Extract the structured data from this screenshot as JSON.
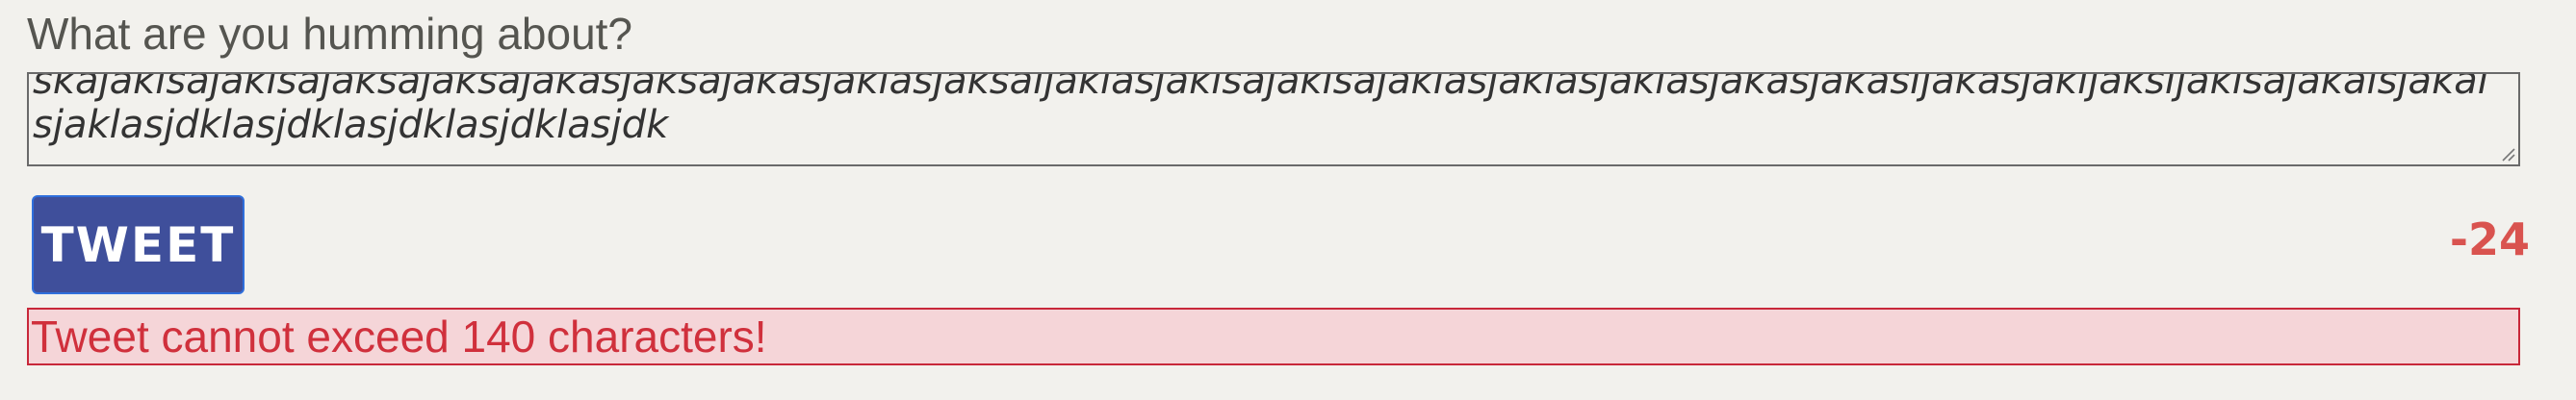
{
  "form": {
    "prompt": "What are you humming about?",
    "textarea_value": "skajaklsajaklsajaksajaksajakasjaksajakasjaklasjaksaljaklasjaklsajaklsajaklasjaklasjaklasjakasjakasljakasjakljaksljaklsajakalsjakalsjaklasjdklasjdklasjdklasjdklasjdk",
    "tweet_button_label": "TWEET",
    "char_counter": "-24",
    "error_message": "Tweet cannot exceed 140 characters!"
  },
  "colors": {
    "background": "#f2f1ed",
    "button_bg": "#3f4f9b",
    "counter": "#d9534f",
    "error_bg": "#f5d5d8",
    "error_border": "#c8283a",
    "error_text": "#d0303c"
  },
  "icons": {
    "resize_handle": "resize-grip-icon"
  }
}
